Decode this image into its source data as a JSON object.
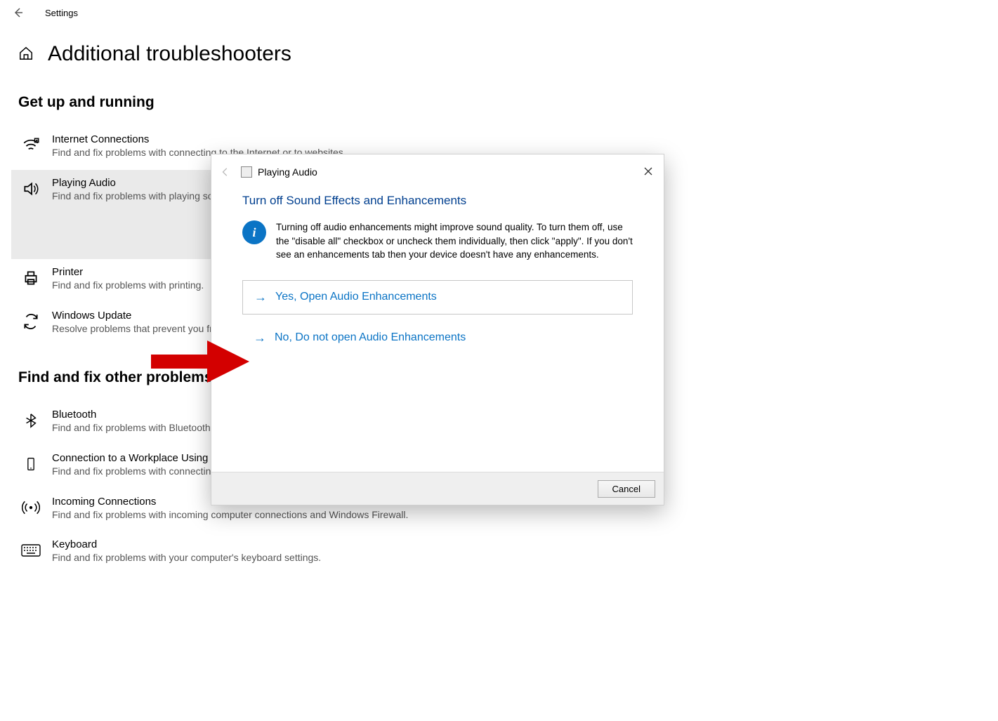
{
  "titlebar": {
    "label": "Settings"
  },
  "page": {
    "title": "Additional troubleshooters"
  },
  "section1": {
    "title": "Get up and running"
  },
  "section2": {
    "title": "Find and fix other problems"
  },
  "items": {
    "internet": {
      "title": "Internet Connections",
      "desc": "Find and fix problems with connecting to the Internet or to websites."
    },
    "audio": {
      "title": "Playing Audio",
      "desc": "Find and fix problems with playing sound."
    },
    "printer": {
      "title": "Printer",
      "desc": "Find and fix problems with printing."
    },
    "update": {
      "title": "Windows Update",
      "desc": "Resolve problems that prevent you from updating Windows."
    },
    "bluetooth": {
      "title": "Bluetooth",
      "desc": "Find and fix problems with Bluetooth devices."
    },
    "workplace": {
      "title": "Connection to a Workplace Using DirectAccess",
      "desc": "Find and fix problems with connecting to your workplace network using DirectAccess."
    },
    "incoming": {
      "title": "Incoming Connections",
      "desc": "Find and fix problems with incoming computer connections and Windows Firewall."
    },
    "keyboard": {
      "title": "Keyboard",
      "desc": "Find and fix problems with your computer's keyboard settings."
    }
  },
  "dialog": {
    "title": "Playing Audio",
    "heading": "Turn off Sound Effects and Enhancements",
    "info_glyph": "i",
    "info": "Turning off audio enhancements might improve sound quality. To turn them off, use the \"disable all\" checkbox or uncheck them individually, then click \"apply\". If you don't see an enhancements tab then your device doesn't have any enhancements.",
    "option_yes": "Yes, Open Audio Enhancements",
    "option_no": "No, Do not open Audio Enhancements",
    "cancel": "Cancel"
  }
}
